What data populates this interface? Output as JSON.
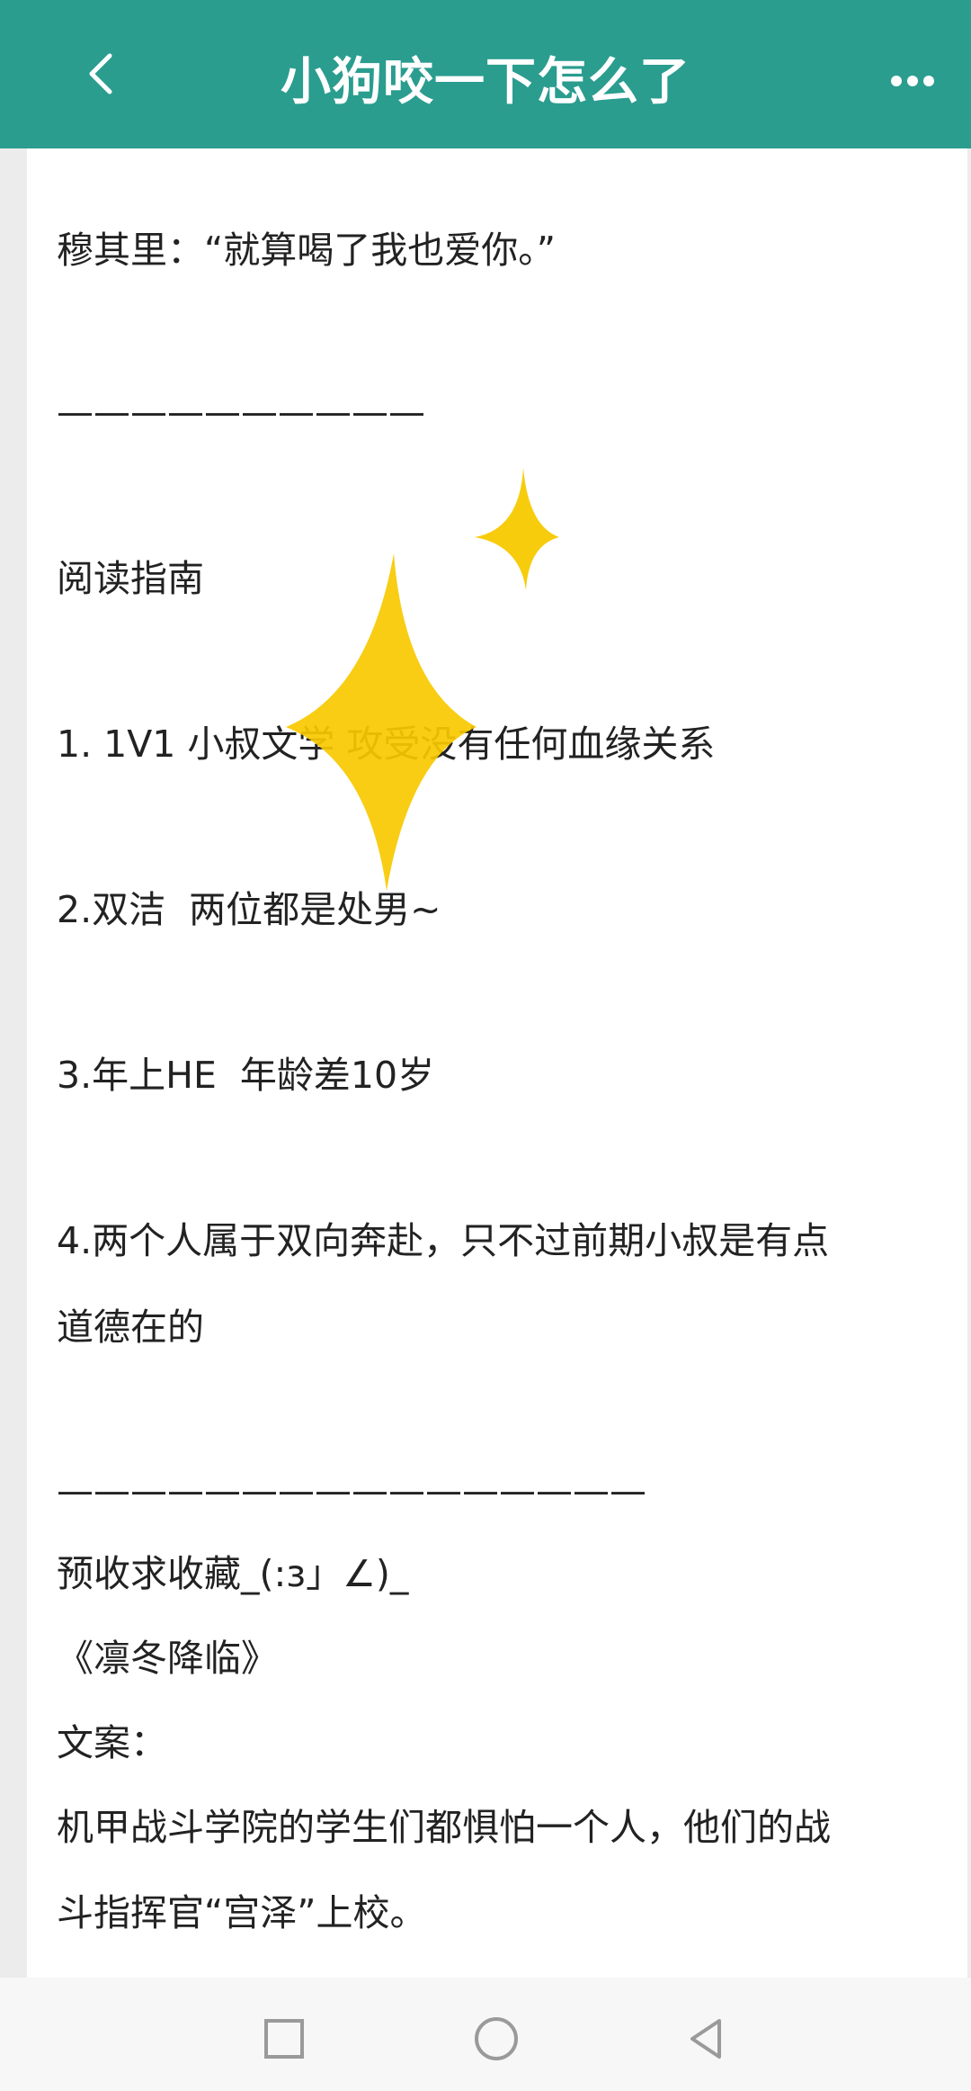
{
  "header": {
    "title": "小狗咬一下怎么了",
    "back_icon": "chevron-left-icon",
    "more_icon": "more-horizontal-icon",
    "bg_color": "#2a9d8f"
  },
  "content": {
    "lines": [
      "穆其里：“就算喝了我也爱你。”",
      "——————————",
      "阅读指南",
      "1. 1V1 小叔文学 攻受没有任何血缘关系",
      "2.双洁  两位都是处男~",
      "3.年上HE  年龄差10岁",
      "4.两个人属于双向奔赴，只不过前期小叔是有点",
      "道德在的",
      "————————————————",
      "预收求收藏_(:з」∠)_",
      "《凛冬降临》",
      "文案：",
      "机甲战斗学院的学生们都惧怕一个人，他们的战",
      "斗指挥官“宫泽”上校。"
    ]
  },
  "decorations": {
    "sparkle_color": "#f7c900"
  },
  "navbar": {
    "recents_icon": "square-icon",
    "home_icon": "circle-icon",
    "back_icon": "triangle-back-icon"
  }
}
